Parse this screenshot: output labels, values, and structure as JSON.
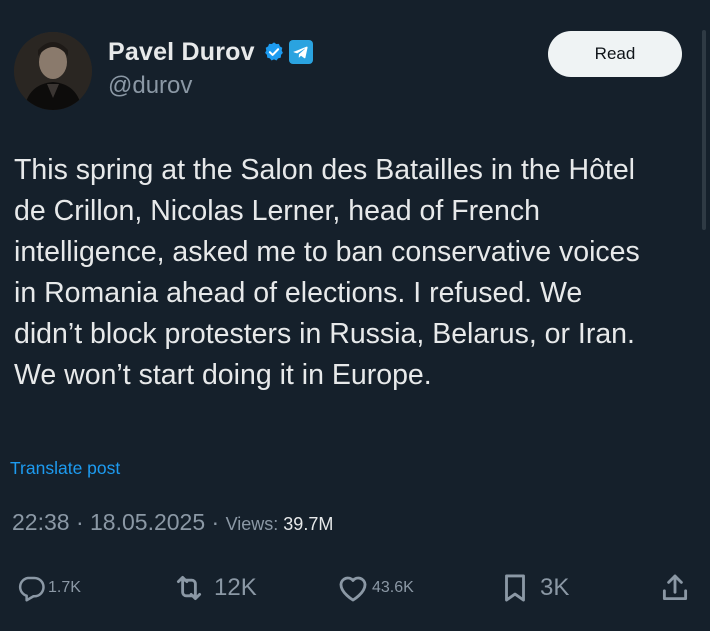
{
  "author": {
    "name": "Pavel Durov",
    "handle": "@durov",
    "verified_icon": "verified-badge-icon",
    "platform_icon": "telegram-icon"
  },
  "header": {
    "read_button_label": "Read"
  },
  "post": {
    "text": "This spring at the Salon des Batailles in the Hôtel\nde Crillon, Nicolas Lerner, head of French\nintelligence, asked me to ban conservative voices\nin Romania ahead of elections. I refused. We\ndidn’t block protesters in Russia, Belarus, or Iran.\nWe won’t start doing it in Europe.",
    "translate_label": "Translate post"
  },
  "meta": {
    "time": "22:38",
    "separator": " · ",
    "date": "18.05.2025",
    "views_label": "Views: ",
    "views_count": "39.7M"
  },
  "actions": {
    "replies": "1.7K",
    "reposts": "12K",
    "likes": "43.6K",
    "bookmarks": "3K"
  },
  "colors": {
    "background": "#15202b",
    "text": "#e7e9ea",
    "muted": "#8b98a5",
    "link": "#1d9bf0",
    "verified": "#1d9bf0",
    "telegram": "#2aa3e0"
  }
}
